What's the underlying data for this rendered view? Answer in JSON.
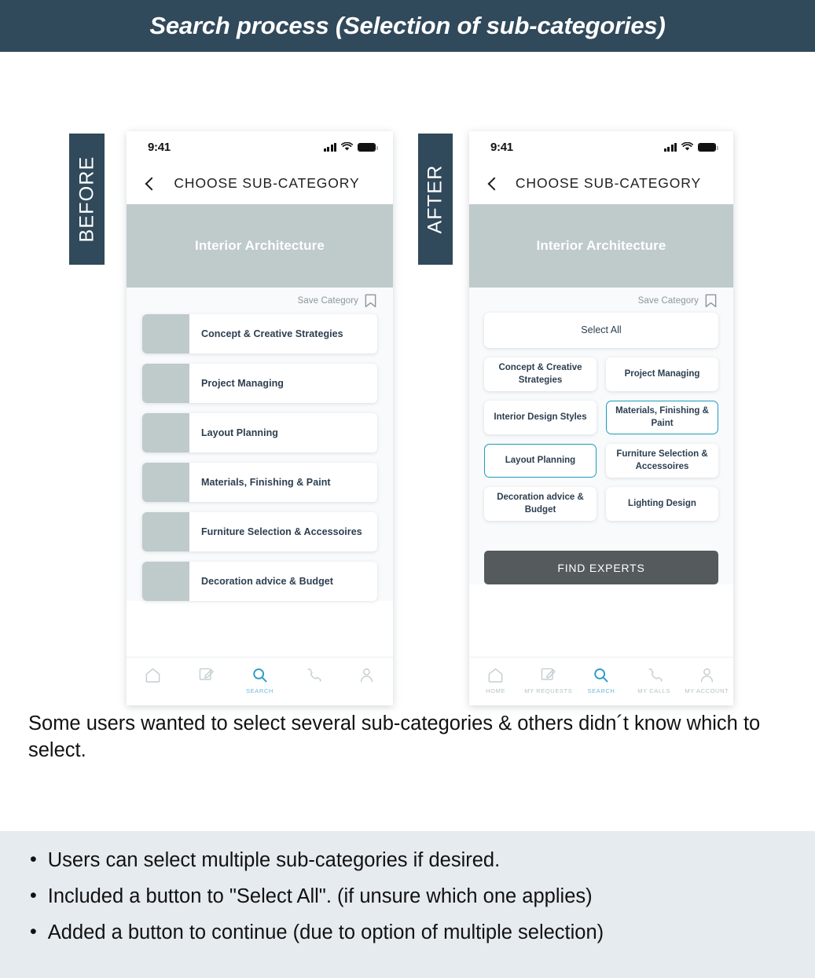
{
  "header": {
    "title": "Search process (Selection of sub-categories)"
  },
  "labels": {
    "before": "BEFORE",
    "after": "AFTER"
  },
  "colors": {
    "header_bg": "#30495b",
    "banner": "#bfcacb",
    "selected_border": "#1c9cbd",
    "cta_button": "#555a5c",
    "solution_bg": "#e6ebf0",
    "active_tab": "#6fb9d4"
  },
  "before_screen": {
    "status": {
      "time": "9:41",
      "signal_icon": "cellular-signal-icon",
      "wifi_icon": "wifi-icon",
      "battery_icon": "battery-icon"
    },
    "nav": {
      "back_icon": "back-chevron-icon",
      "title": "CHOOSE SUB-CATEGORY"
    },
    "banner": {
      "text": "Interior Architecture"
    },
    "save": {
      "label": "Save Category",
      "icon": "bookmark-icon"
    },
    "items": [
      {
        "label": "Concept & Creative Strategies"
      },
      {
        "label": "Project Managing"
      },
      {
        "label": "Layout Planning"
      },
      {
        "label": "Materials, Finishing & Paint"
      },
      {
        "label": "Furniture Selection & Accessoires"
      },
      {
        "label": "Decoration advice & Budget"
      }
    ],
    "tabs": [
      {
        "label": "",
        "icon": "home-icon",
        "active": false
      },
      {
        "label": "",
        "icon": "my-requests-icon",
        "active": false
      },
      {
        "label": "SEARCH",
        "icon": "search-icon",
        "active": true
      },
      {
        "label": "",
        "icon": "phone-icon",
        "active": false
      },
      {
        "label": "",
        "icon": "account-icon",
        "active": false
      }
    ]
  },
  "after_screen": {
    "status": {
      "time": "9:41",
      "signal_icon": "cellular-signal-icon",
      "wifi_icon": "wifi-icon",
      "battery_icon": "battery-icon"
    },
    "nav": {
      "back_icon": "back-chevron-icon",
      "title": "CHOOSE SUB-CATEGORY"
    },
    "banner": {
      "text": "Interior Architecture"
    },
    "save": {
      "label": "Save Category",
      "icon": "bookmark-icon"
    },
    "select_all": {
      "label": "Select All",
      "selected": false
    },
    "chips": [
      {
        "label": "Concept & Creative Strategies",
        "selected": false
      },
      {
        "label": "Project Managing",
        "selected": false
      },
      {
        "label": "Interior Design Styles",
        "selected": false
      },
      {
        "label": "Materials, Finishing & Paint",
        "selected": true
      },
      {
        "label": "Layout Planning",
        "selected": true
      },
      {
        "label": "Furniture Selection & Accessoires",
        "selected": false
      },
      {
        "label": "Decoration advice & Budget",
        "selected": false
      },
      {
        "label": "Lighting Design",
        "selected": false
      }
    ],
    "cta": {
      "label": "FIND EXPERTS"
    },
    "tabs": [
      {
        "label": "HOME",
        "icon": "home-icon",
        "active": false
      },
      {
        "label": "MY REQUESTS",
        "icon": "my-requests-icon",
        "active": false
      },
      {
        "label": "SEARCH",
        "icon": "search-icon",
        "active": true
      },
      {
        "label": "MY CALLS",
        "icon": "phone-icon",
        "active": false
      },
      {
        "label": "MY ACCOUNT",
        "icon": "account-icon",
        "active": false
      }
    ]
  },
  "problem": {
    "text": "Some users wanted to select several sub-categories & others didn´t know which to select."
  },
  "solution": {
    "bullets": [
      "Users can select multiple sub-categories if desired.",
      "Included a button to \"Select All\". (if unsure which one applies)",
      "Added a button to continue (due to option of multiple selection)"
    ]
  }
}
